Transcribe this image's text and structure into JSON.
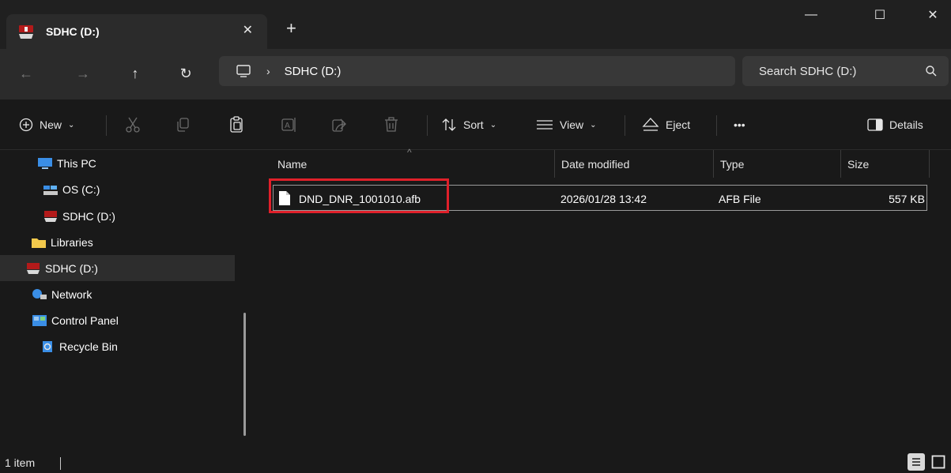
{
  "window": {
    "tab_title": "SDHC (D:)",
    "tab_close": "✕",
    "new_tab": "+",
    "minimize": "—",
    "maximize": "☐",
    "close": "✕"
  },
  "address": {
    "back": "←",
    "forward": "→",
    "up": "↑",
    "refresh": "↻",
    "separator": "›",
    "breadcrumb": "SDHC (D:)",
    "search_placeholder": "Search SDHC (D:)"
  },
  "commands": {
    "new": "New",
    "sort": "Sort",
    "view": "View",
    "eject": "Eject",
    "more": "•••",
    "details": "Details",
    "chevron": "⌄"
  },
  "sidebar": {
    "items": [
      {
        "label": "This PC",
        "icon": "monitor-icon"
      },
      {
        "label": "OS (C:)",
        "icon": "drive-icon"
      },
      {
        "label": "SDHC (D:)",
        "icon": "sd-drive-icon"
      },
      {
        "label": "Libraries",
        "icon": "folder-icon"
      },
      {
        "label": "SDHC (D:)",
        "icon": "sd-drive-icon",
        "selected": true
      },
      {
        "label": "Network",
        "icon": "network-icon"
      },
      {
        "label": "Control Panel",
        "icon": "control-panel-icon"
      },
      {
        "label": "Recycle Bin",
        "icon": "recycle-bin-icon"
      }
    ]
  },
  "filelist": {
    "columns": {
      "name": "Name",
      "date": "Date modified",
      "type": "Type",
      "size": "Size"
    },
    "sort_caret": "^",
    "rows": [
      {
        "name": "DND_DNR_1001010.afb",
        "date": "2026/01/28 13:42",
        "type": "AFB File",
        "size": "557 KB"
      }
    ]
  },
  "status": {
    "count": "1 item"
  },
  "colors": {
    "background": "#191919",
    "highlight": "#e0202a",
    "toolbar": "#2b2b2b"
  }
}
